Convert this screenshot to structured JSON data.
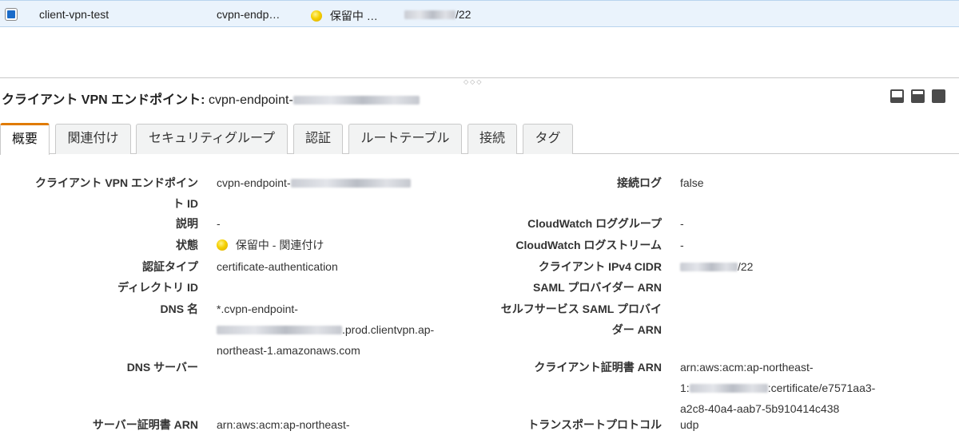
{
  "selected_row": {
    "name": "client-vpn-test",
    "endpoint": "cvpn-endp…",
    "status": "保留中 …",
    "cidr_suffix": "/22"
  },
  "detail": {
    "title_label": "クライアント VPN エンドポイント:",
    "title_value": "cvpn-endpoint-"
  },
  "tabs": [
    "概要",
    "関連付け",
    "セキュリティグループ",
    "認証",
    "ルートテーブル",
    "接続",
    "タグ"
  ],
  "left_fields": {
    "endpoint_id": {
      "label_1": "クライアント VPN エンドポイン",
      "label_2": "ト ID",
      "value": "cvpn-endpoint-"
    },
    "description": {
      "label": "説明",
      "value": "-"
    },
    "state": {
      "label": "状態",
      "value": "保留中 - 関連付け"
    },
    "auth_type": {
      "label": "認証タイプ",
      "value": "certificate-authentication"
    },
    "directory_id": {
      "label": "ディレクトリ ID",
      "value": ""
    },
    "dns_name": {
      "label": "DNS 名",
      "value_1": "*.cvpn-endpoint-",
      "value_2": ".prod.clientvpn.ap-",
      "value_3": "northeast-1.amazonaws.com"
    },
    "dns_server": {
      "label": "DNS サーバー",
      "value": ""
    },
    "server_cert": {
      "label": "サーバー証明書 ARN",
      "value": "arn:aws:acm:ap-northeast-"
    }
  },
  "right_fields": {
    "conn_log": {
      "label": "接続ログ",
      "value": "false"
    },
    "cw_group": {
      "label": "CloudWatch ロググループ",
      "value": "-"
    },
    "cw_stream": {
      "label": "CloudWatch ログストリーム",
      "value": "-"
    },
    "ipv4_cidr": {
      "label": "クライアント IPv4 CIDR",
      "value": "/22"
    },
    "saml_arn": {
      "label": "SAML プロバイダー ARN",
      "value": ""
    },
    "self_saml": {
      "label_1": "セルフサービス SAML プロバイ",
      "label_2": "ダー ARN",
      "value": ""
    },
    "client_cert": {
      "label": "クライアント証明書 ARN",
      "value_1": "arn:aws:acm:ap-northeast-",
      "value_2_prefix": "1:",
      "value_2_suffix": ":certificate/e7571aa3-",
      "value_3": "a2c8-40a4-aab7-5b910414c438"
    },
    "transport": {
      "label": "トランスポートプロトコル",
      "value": "udp"
    }
  }
}
